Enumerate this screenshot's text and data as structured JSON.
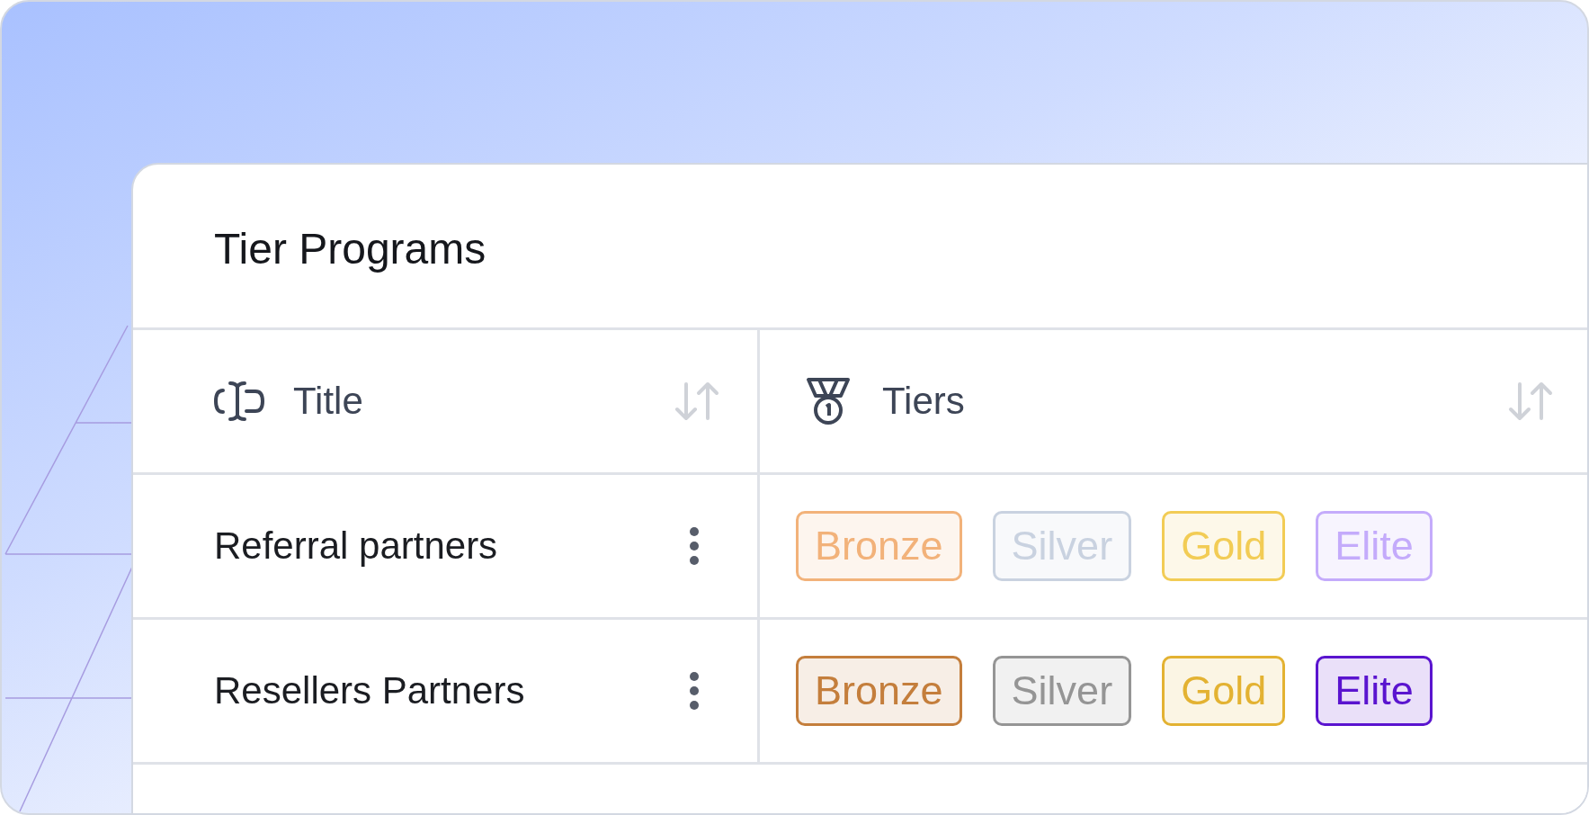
{
  "card": {
    "title": "Tier Programs"
  },
  "table": {
    "columns": [
      {
        "label": "Title"
      },
      {
        "label": "Tiers"
      }
    ],
    "rows": [
      {
        "title": "Referral partners",
        "tiers": [
          {
            "label": "Bronze",
            "color": "#f2b27a"
          },
          {
            "label": "Silver",
            "color": "#c9d2e0"
          },
          {
            "label": "Gold",
            "color": "#f2cc55"
          },
          {
            "label": "Elite",
            "color": "#c4abfb"
          }
        ]
      },
      {
        "title": "Resellers Partners",
        "tiers": [
          {
            "label": "Bronze",
            "color": "#c47e3c"
          },
          {
            "label": "Silver",
            "color": "#959595"
          },
          {
            "label": "Gold",
            "color": "#e3b232"
          },
          {
            "label": "Elite",
            "color": "#5a14cf"
          }
        ]
      }
    ]
  }
}
